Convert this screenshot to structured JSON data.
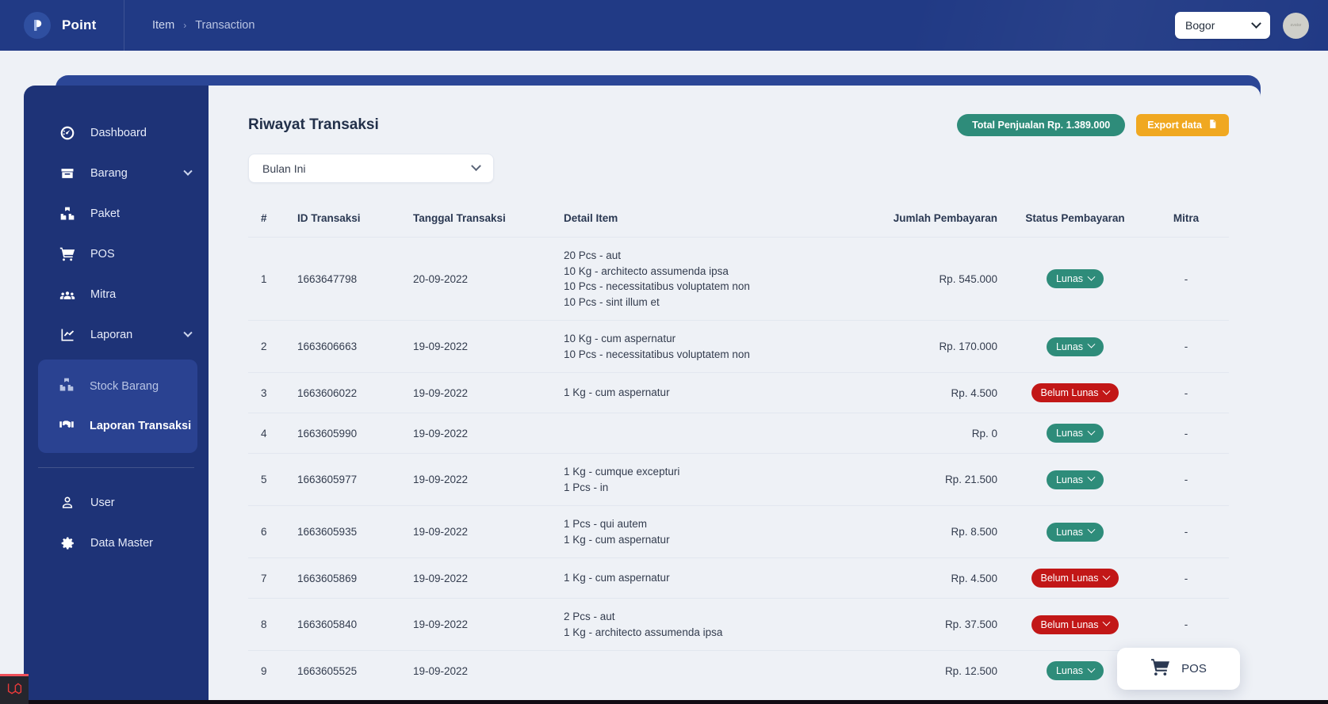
{
  "topbar": {
    "brand_name": "Point",
    "logo_icon": "point-logo-icon",
    "breadcrumb": {
      "parent": "Item",
      "separator": "›",
      "current": "Transaction"
    },
    "location_select": {
      "value": "Bogor",
      "icon": "chevron-down-icon"
    },
    "avatar": {
      "label": "avatar"
    }
  },
  "sidebar": {
    "items": [
      {
        "label": "Dashboard",
        "icon": "dashboard-gauge-icon",
        "has_caret": false,
        "active": false
      },
      {
        "label": "Barang",
        "icon": "box-icon",
        "has_caret": true,
        "active": false
      },
      {
        "label": "Paket",
        "icon": "packages-icon",
        "has_caret": false,
        "active": false
      },
      {
        "label": "POS",
        "icon": "shopping-cart-icon",
        "has_caret": false,
        "active": false
      },
      {
        "label": "Mitra",
        "icon": "users-group-icon",
        "has_caret": false,
        "active": false
      },
      {
        "label": "Laporan",
        "icon": "chart-line-icon",
        "has_caret": true,
        "active": false
      }
    ],
    "submenu": [
      {
        "label": "Stock Barang",
        "icon": "packages-icon",
        "active": false
      },
      {
        "label": "Laporan Transaksi",
        "icon": "handshake-icon",
        "active": true
      }
    ],
    "footer_items": [
      {
        "label": "User",
        "icon": "user-icon"
      },
      {
        "label": "Data Master",
        "icon": "gear-icon"
      }
    ]
  },
  "main": {
    "page_title": "Riwayat Transaksi",
    "total_button": "Total Penjualan Rp. 1.389.000",
    "export_button": "Export data",
    "export_icon": "file-export-icon",
    "period_filter": {
      "value": "Bulan Ini",
      "icon": "chevron-down-icon"
    },
    "columns": [
      "#",
      "ID Transaksi",
      "Tanggal Transaksi",
      "Detail Item",
      "Jumlah Pembayaran",
      "Status Pembayaran",
      "Mitra"
    ],
    "rows": [
      {
        "no": "1",
        "id": "1663647798",
        "date": "20-09-2022",
        "details": [
          "20 Pcs - aut",
          "10 Kg - architecto assumenda ipsa",
          "10 Pcs - necessitatibus voluptatem non",
          "10 Pcs - sint illum et"
        ],
        "amount": "Rp. 545.000",
        "status": "Lunas",
        "status_kind": "lunas",
        "mitra": "-"
      },
      {
        "no": "2",
        "id": "1663606663",
        "date": "19-09-2022",
        "details": [
          "10 Kg - cum aspernatur",
          "10 Pcs - necessitatibus voluptatem non"
        ],
        "amount": "Rp. 170.000",
        "status": "Lunas",
        "status_kind": "lunas",
        "mitra": "-"
      },
      {
        "no": "3",
        "id": "1663606022",
        "date": "19-09-2022",
        "details": [
          "1 Kg - cum aspernatur"
        ],
        "amount": "Rp. 4.500",
        "status": "Belum Lunas",
        "status_kind": "belum",
        "mitra": "-"
      },
      {
        "no": "4",
        "id": "1663605990",
        "date": "19-09-2022",
        "details": [],
        "amount": "Rp. 0",
        "status": "Lunas",
        "status_kind": "lunas",
        "mitra": "-"
      },
      {
        "no": "5",
        "id": "1663605977",
        "date": "19-09-2022",
        "details": [
          "1 Kg - cumque excepturi",
          "1 Pcs - in"
        ],
        "amount": "Rp. 21.500",
        "status": "Lunas",
        "status_kind": "lunas",
        "mitra": "-"
      },
      {
        "no": "6",
        "id": "1663605935",
        "date": "19-09-2022",
        "details": [
          "1 Pcs - qui autem",
          "1 Kg - cum aspernatur"
        ],
        "amount": "Rp. 8.500",
        "status": "Lunas",
        "status_kind": "lunas",
        "mitra": "-"
      },
      {
        "no": "7",
        "id": "1663605869",
        "date": "19-09-2022",
        "details": [
          "1 Kg - cum aspernatur"
        ],
        "amount": "Rp. 4.500",
        "status": "Belum Lunas",
        "status_kind": "belum",
        "mitra": "-"
      },
      {
        "no": "8",
        "id": "1663605840",
        "date": "19-09-2022",
        "details": [
          "2 Pcs - aut",
          "1 Kg - architecto assumenda ipsa"
        ],
        "amount": "Rp. 37.500",
        "status": "Belum Lunas",
        "status_kind": "belum",
        "mitra": "-"
      },
      {
        "no": "9",
        "id": "1663605525",
        "date": "19-09-2022",
        "details": [],
        "amount": "Rp. 12.500",
        "status": "Lunas",
        "status_kind": "lunas",
        "mitra": "-"
      }
    ]
  },
  "pos_fab": {
    "label": "POS",
    "icon": "shopping-cart-icon"
  },
  "debugbar": {
    "icon": "laravel-logo-icon"
  },
  "colors": {
    "brand_navy": "#213a85",
    "sidebar_navy": "#1e3377",
    "submenu_navy": "#2a4291",
    "page_bg": "#eef1f6",
    "green": "#2e8c7a",
    "red": "#c21717",
    "orange": "#f0a821"
  }
}
